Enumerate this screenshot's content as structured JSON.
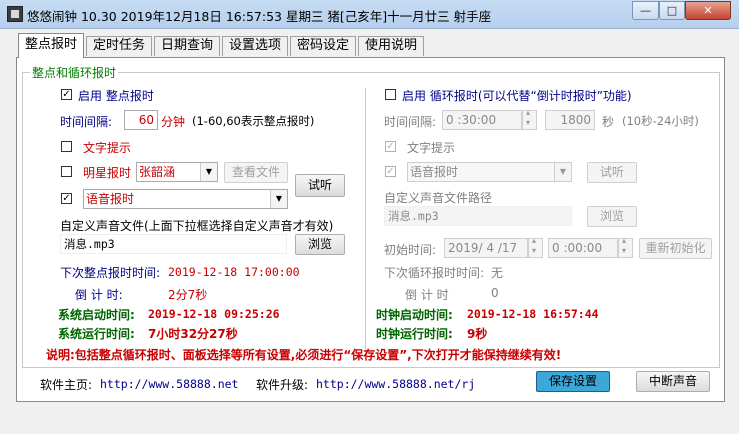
{
  "window": {
    "title": "悠悠闹钟 10.30 2019年12月18日 16:57:53 星期三 猪[己亥年]十一月廿三 射手座",
    "min_glyph": "—",
    "max_glyph": "□",
    "close_glyph": "✕"
  },
  "tabs": [
    "整点报时",
    "定时任务",
    "日期查询",
    "设置选项",
    "密码设定",
    "使用说明"
  ],
  "group_title": "整点和循环报时",
  "left": {
    "enable_label": "启用  整点报时",
    "interval_label": "时间间隔:",
    "interval_value": "60",
    "interval_unit": "分钟",
    "interval_hint": "(1-60,60表示整点报时)",
    "text_tip_label": "文字提示",
    "star_label": "明星报时",
    "star_value": "张韶涵",
    "view_file_button": "查看文件",
    "voice_label": "语音报时",
    "listen_button": "试听",
    "custom_sound_label": "自定义声音文件(上面下拉框选择自定义声音才有效)",
    "custom_sound_value": "消息.mp3",
    "browse_button": "浏览",
    "next_label": "下次整点报时时间:",
    "next_value": "2019-12-18 17:00:00",
    "countdown_label": "倒 计 时:",
    "countdown_value": "2分7秒"
  },
  "right": {
    "enable_label": "启用  循环报时(可以代替“倒计时报时”功能)",
    "interval_label": "时间间隔:",
    "interval_value": "0 :30:00",
    "seconds_value": "1800",
    "seconds_unit": "秒",
    "seconds_hint": "(10秒-24小时)",
    "text_tip_label": "文字提示",
    "voice_value": "语音报时",
    "listen_button": "试听",
    "custom_path_label": "自定义声音文件路径",
    "custom_path_value": "消息.mp3",
    "browse_button": "浏览",
    "init_time_label": "初始时间:",
    "init_date_value": "2019/ 4 /17",
    "init_time_value": "0 :00:00",
    "reinit_button": "重新初始化",
    "next_label": "下次循环报时时间:",
    "next_value": "无",
    "countdown_label": "倒  计  时",
    "countdown_value": "0"
  },
  "status": {
    "sys_start_label": "系统启动时间:",
    "sys_start_value": "2019-12-18  09:25:26",
    "clock_start_label": "时钟启动时间:",
    "clock_start_value": "2019-12-18  16:57:44",
    "sys_run_label": "系统运行时间:",
    "sys_run_value": "7小时32分27秒",
    "clock_run_label": "时钟运行时间:",
    "clock_run_value": "9秒"
  },
  "note": "说明:包括整点循环报时、面板选择等所有设置,必须进行“保存设置”,下次打开才能保持继续有效!",
  "footer": {
    "home_label": "软件主页:",
    "home_url": "http://www.58888.net",
    "upgrade_label": "软件升级:",
    "upgrade_url": "http://www.58888.net/rj",
    "save_button": "保存设置",
    "stop_sound_button": "中断声音"
  },
  "checks": {
    "left_enable": "☑",
    "left_text": "",
    "left_star": "",
    "left_voice": "✓",
    "right_enable": "",
    "right_text": "✓",
    "right_voice": "✓"
  },
  "dropdown_glyph": "▼"
}
